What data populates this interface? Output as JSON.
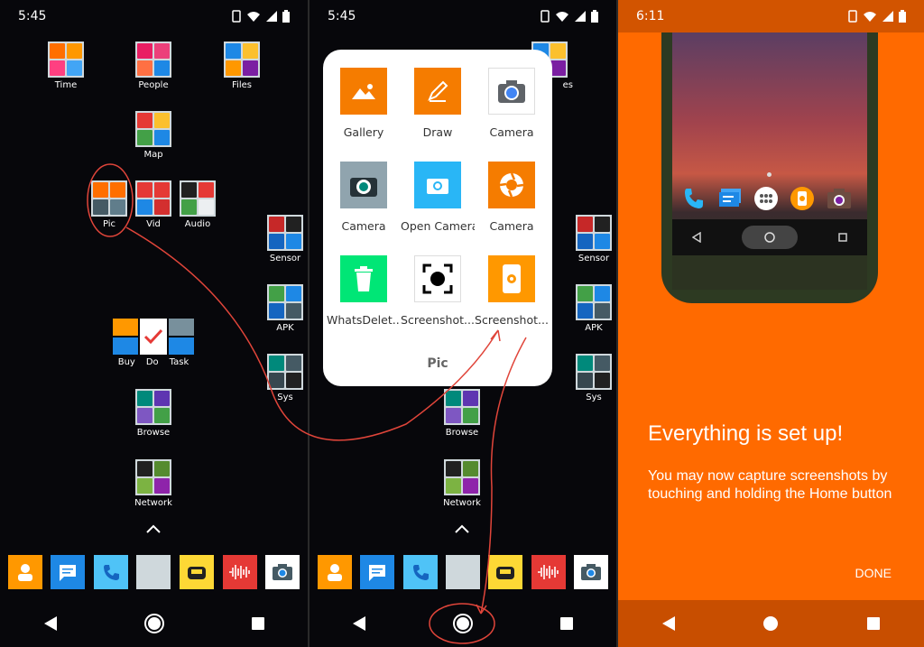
{
  "panel1": {
    "time": "5:45",
    "icons": [
      {
        "label": "Time"
      },
      {
        "label": "People"
      },
      {
        "label": "Files"
      },
      {
        "label": "Map"
      },
      {
        "label": "Pic"
      },
      {
        "label": "Vid"
      },
      {
        "label": "Audio"
      },
      {
        "label": "Sensor"
      },
      {
        "label": "APK"
      },
      {
        "label": "Sys"
      },
      {
        "label": "Buy"
      },
      {
        "label": "Do"
      },
      {
        "label": "Task"
      },
      {
        "label": "Browse"
      },
      {
        "label": "Network"
      }
    ]
  },
  "panel2": {
    "time": "5:45",
    "folder": {
      "name": "Pic",
      "apps": [
        {
          "label": "Gallery"
        },
        {
          "label": "Draw"
        },
        {
          "label": "Camera"
        },
        {
          "label": "Camera"
        },
        {
          "label": "Open Camera"
        },
        {
          "label": "Camera"
        },
        {
          "label": "WhatsDelet..."
        },
        {
          "label": "Screenshot..."
        },
        {
          "label": "Screenshot..."
        }
      ]
    },
    "side_icons": [
      {
        "label": "Sensor"
      },
      {
        "label": "APK"
      },
      {
        "label": "Sys"
      },
      {
        "label": "Browse"
      },
      {
        "label": "Network"
      },
      {
        "label": "es"
      }
    ]
  },
  "panel3": {
    "time": "6:11",
    "title": "Everything is set up!",
    "body": "You may now capture screenshots by touching and holding the Home button",
    "done": "DONE"
  },
  "colors": {
    "orange": "#ff6a00",
    "callout": "#e0453a"
  }
}
